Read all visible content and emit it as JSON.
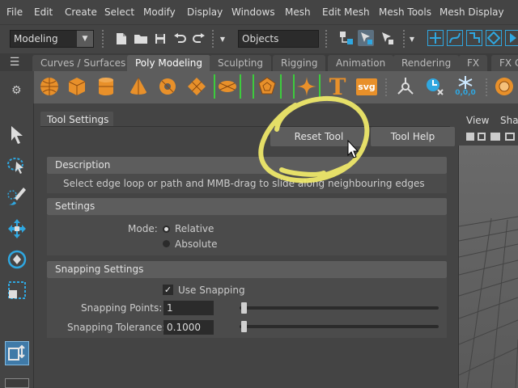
{
  "menu": [
    "File",
    "Edit",
    "Create",
    "Select",
    "Modify",
    "Display",
    "Windows",
    "Mesh",
    "Edit Mesh",
    "Mesh Tools",
    "Mesh Display"
  ],
  "status": {
    "menuset": "Modeling",
    "selection_mode": "Objects"
  },
  "shelf_tabs": [
    "Curves / Surfaces",
    "Poly Modeling",
    "Sculpting",
    "Rigging",
    "Animation",
    "Rendering",
    "FX",
    "FX C"
  ],
  "shelf_active_tab": "Poly Modeling",
  "shelf_icon_labels": {
    "text_tool": "T",
    "svg_tool": "svg",
    "coords": "0,0,0"
  },
  "panel": {
    "tab": "Tool Settings",
    "reset_button": "Reset Tool",
    "help_button": "Tool Help",
    "description": {
      "heading": "Description",
      "text": "Select edge loop or path and MMB-drag to slide along neighbouring edges"
    },
    "settings": {
      "heading": "Settings",
      "mode_label": "Mode:",
      "options": [
        "Relative",
        "Absolute"
      ],
      "selected": "Relative"
    },
    "snapping": {
      "heading": "Snapping Settings",
      "use_snapping_label": "Use Snapping",
      "use_snapping": true,
      "points_label": "Snapping Points:",
      "points_value": "1",
      "tolerance_label": "Snapping Tolerance:",
      "tolerance_value": "0.1000",
      "points_slider_fraction": 0.01,
      "tolerance_slider_fraction": 0.01
    }
  },
  "viewport": {
    "menu": [
      "View",
      "Sha"
    ]
  },
  "colors": {
    "annotation": "#f2ec6a",
    "accent_blue": "#2fa7e0",
    "selection_green": "#3dcc3d",
    "shelf_orange": "#e8902a"
  }
}
